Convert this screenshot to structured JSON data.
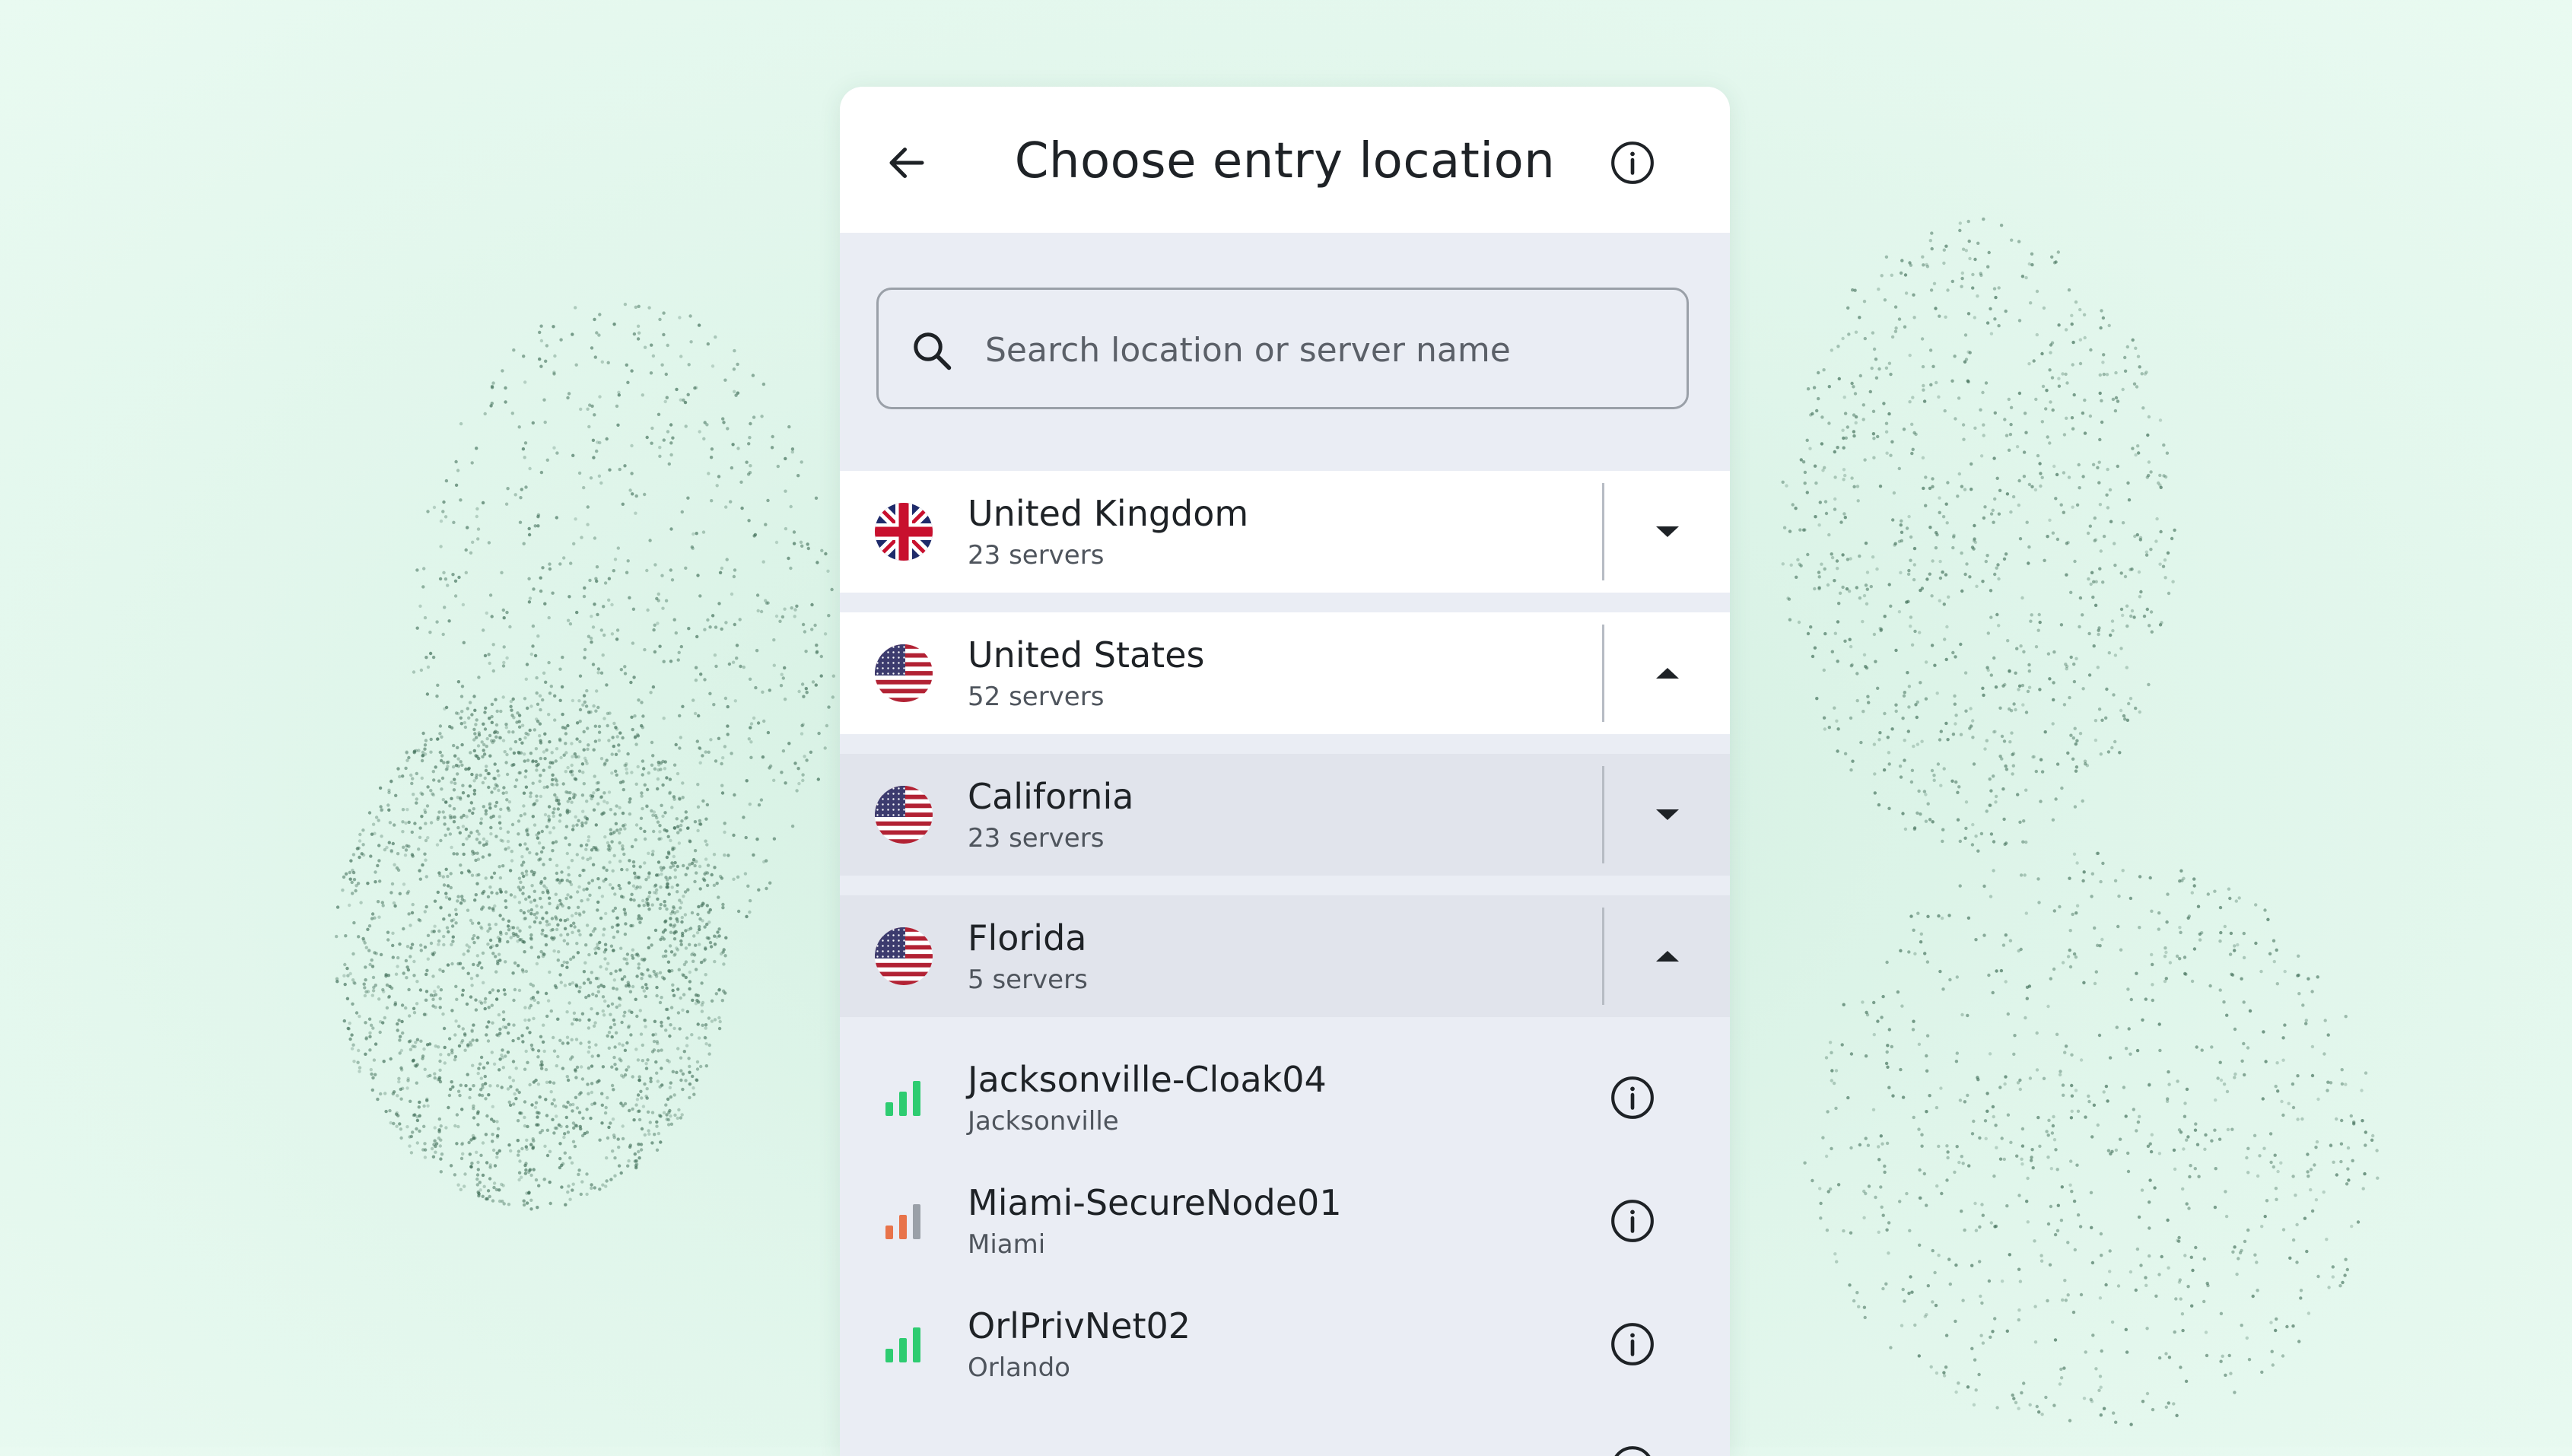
{
  "header": {
    "title": "Choose entry location",
    "back_icon": "arrow-left-icon",
    "info_icon": "info-icon"
  },
  "search": {
    "placeholder": "Search location or server name",
    "value": "",
    "icon": "search-icon"
  },
  "countries": [
    {
      "name": "United Kingdom",
      "servers": "23 servers",
      "flag": "uk-flag-icon",
      "expanded": false
    },
    {
      "name": "United States",
      "servers": "52 servers",
      "flag": "us-flag-icon",
      "expanded": true
    }
  ],
  "regions": [
    {
      "name": "California",
      "servers": "23 servers",
      "flag": "us-flag-icon",
      "expanded": false
    },
    {
      "name": "Florida",
      "servers": "5 servers",
      "flag": "us-flag-icon",
      "expanded": true
    }
  ],
  "servers": [
    {
      "name": "Jacksonville-Cloak04",
      "city": "Jacksonville",
      "signal_level": 3,
      "signal_color": "#2ecc71"
    },
    {
      "name": "Miami-SecureNode01",
      "city": "Miami",
      "signal_level": 2,
      "signal_color": "#e8734a"
    },
    {
      "name": "OrlPrivNet02",
      "city": "Orlando",
      "signal_level": 3,
      "signal_color": "#2ecc71"
    }
  ],
  "colors": {
    "background": "#dff5ea",
    "panel": "#eaedf4",
    "row_white": "#ffffff",
    "row_grey": "#e1e4ec",
    "text_primary": "#1e2226",
    "text_secondary": "#4f555d",
    "signal_good": "#2ecc71",
    "signal_weak": "#e8734a",
    "signal_inactive": "#9aa0a8"
  }
}
